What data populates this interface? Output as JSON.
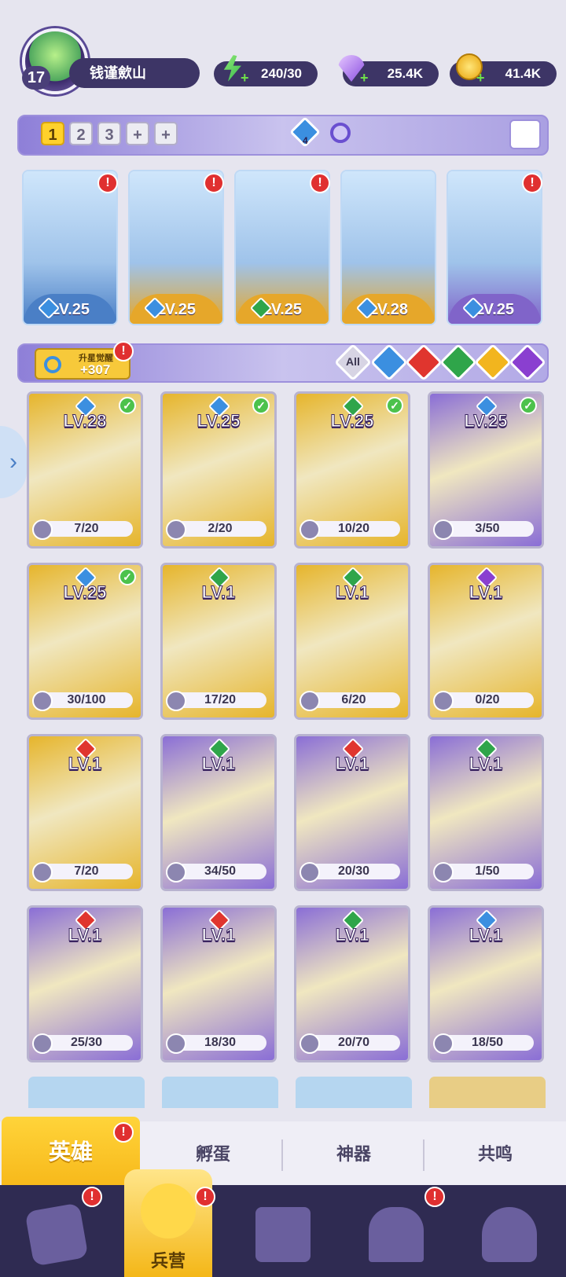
{
  "player": {
    "level": "17",
    "name": "钱谨歛山"
  },
  "resources": {
    "energy": "240/30",
    "gems": "25.4K",
    "gold": "41.4K"
  },
  "team_tabs": {
    "items": [
      "1",
      "2",
      "3",
      "+",
      "+"
    ],
    "selected": "1",
    "badge_count": "4"
  },
  "team_slots": [
    {
      "level": "LV.25",
      "element": "water",
      "bg": "#4a7fc6"
    },
    {
      "level": "LV.25",
      "element": "water",
      "bg": "#e6a72a"
    },
    {
      "level": "LV.25",
      "element": "wood",
      "bg": "#e6a72a"
    },
    {
      "level": "LV.28",
      "element": "water",
      "bg": "#e6a72a"
    },
    {
      "level": "LV.25",
      "element": "water",
      "bg": "#8064c9"
    }
  ],
  "awaken": {
    "label": "升星觉醒",
    "value": "+307"
  },
  "filters": {
    "all": "All",
    "elements": [
      "water",
      "fire",
      "wood",
      "light",
      "dark"
    ]
  },
  "heroes": [
    {
      "level": "LV.28",
      "progress": "7/20",
      "element": "water",
      "checked": true,
      "bg": "#e6b52c"
    },
    {
      "level": "LV.25",
      "progress": "2/20",
      "element": "water",
      "checked": true,
      "bg": "#e6b52c"
    },
    {
      "level": "LV.25",
      "progress": "10/20",
      "element": "wood",
      "checked": true,
      "bg": "#e6b52c"
    },
    {
      "level": "LV.25",
      "progress": "3/50",
      "element": "water",
      "checked": true,
      "bg": "#8a6ed6"
    },
    {
      "level": "LV.25",
      "progress": "30/100",
      "element": "water",
      "checked": true,
      "bg": "#e6b52c"
    },
    {
      "level": "LV.1",
      "progress": "17/20",
      "element": "wood",
      "checked": false,
      "bg": "#e6b52c"
    },
    {
      "level": "LV.1",
      "progress": "6/20",
      "element": "wood",
      "checked": false,
      "bg": "#e6b52c"
    },
    {
      "level": "LV.1",
      "progress": "0/20",
      "element": "dark",
      "checked": false,
      "bg": "#e6b52c"
    },
    {
      "level": "LV.1",
      "progress": "7/20",
      "element": "fire",
      "checked": false,
      "bg": "#e6b52c"
    },
    {
      "level": "LV.1",
      "progress": "34/50",
      "element": "wood",
      "checked": false,
      "bg": "#8a6ed6"
    },
    {
      "level": "LV.1",
      "progress": "20/30",
      "element": "fire",
      "checked": false,
      "bg": "#8a6ed6"
    },
    {
      "level": "LV.1",
      "progress": "1/50",
      "element": "wood",
      "checked": false,
      "bg": "#8a6ed6"
    },
    {
      "level": "LV.1",
      "progress": "25/30",
      "element": "fire",
      "checked": false,
      "bg": "#8a6ed6"
    },
    {
      "level": "LV.1",
      "progress": "18/30",
      "element": "fire",
      "checked": false,
      "bg": "#8a6ed6"
    },
    {
      "level": "LV.1",
      "progress": "20/70",
      "element": "wood",
      "checked": false,
      "bg": "#8a6ed6"
    },
    {
      "level": "LV.1",
      "progress": "18/50",
      "element": "water",
      "checked": false,
      "bg": "#8a6ed6"
    }
  ],
  "element_colors": {
    "water": "#3b8fe0",
    "fire": "#e0352e",
    "wood": "#2fa54a",
    "light": "#f2b51e",
    "dark": "#8a3fd0"
  },
  "sub_tabs": [
    {
      "label": "英雄",
      "active": true,
      "badge": true
    },
    {
      "label": "孵蛋",
      "active": false,
      "badge": false
    },
    {
      "label": "神器",
      "active": false,
      "badge": false
    },
    {
      "label": "共鸣",
      "active": false,
      "badge": false
    }
  ],
  "bottom_nav": [
    {
      "name": "cards",
      "label": "",
      "badge": true
    },
    {
      "name": "barracks",
      "label": "兵营",
      "badge": true,
      "active": true
    },
    {
      "name": "map",
      "label": "",
      "badge": false
    },
    {
      "name": "castle",
      "label": "",
      "badge": true
    },
    {
      "name": "guild",
      "label": "",
      "badge": false
    }
  ],
  "badge_mark": "!"
}
